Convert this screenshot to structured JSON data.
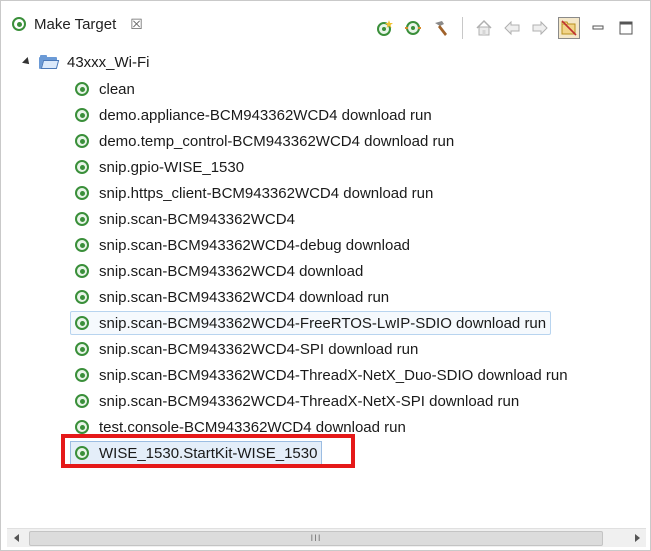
{
  "view": {
    "tab_title": "Make Target",
    "tab_close_glyph": "☒"
  },
  "toolbar": {
    "buttons": [
      {
        "name": "new-target-icon"
      },
      {
        "name": "build-target-icon"
      },
      {
        "name": "edit-target-hammer-icon"
      },
      {
        "name": "home-icon"
      },
      {
        "name": "back-icon"
      },
      {
        "name": "forward-icon"
      },
      {
        "name": "hide-empty-folders-icon"
      },
      {
        "name": "minimize-icon"
      },
      {
        "name": "maximize-icon"
      }
    ]
  },
  "tree": {
    "root": {
      "label": "43xxx_Wi-Fi",
      "expanded": true
    },
    "items": [
      {
        "label": "clean"
      },
      {
        "label": "demo.appliance-BCM943362WCD4 download run"
      },
      {
        "label": "demo.temp_control-BCM943362WCD4 download run"
      },
      {
        "label": "snip.gpio-WISE_1530"
      },
      {
        "label": "snip.https_client-BCM943362WCD4 download run"
      },
      {
        "label": "snip.scan-BCM943362WCD4"
      },
      {
        "label": "snip.scan-BCM943362WCD4-debug download"
      },
      {
        "label": "snip.scan-BCM943362WCD4 download"
      },
      {
        "label": "snip.scan-BCM943362WCD4 download run"
      },
      {
        "label": "snip.scan-BCM943362WCD4-FreeRTOS-LwIP-SDIO download run"
      },
      {
        "label": "snip.scan-BCM943362WCD4-SPI download run"
      },
      {
        "label": "snip.scan-BCM943362WCD4-ThreadX-NetX_Duo-SDIO download run"
      },
      {
        "label": "snip.scan-BCM943362WCD4-ThreadX-NetX-SPI download run"
      },
      {
        "label": "test.console-BCM943362WCD4 download run"
      },
      {
        "label": "WISE_1530.StartKit-WISE_1530"
      }
    ]
  },
  "scrollbar": {
    "grip": "III"
  },
  "colors": {
    "highlight": "#e51919",
    "target_icon": "#3a8f3a"
  }
}
